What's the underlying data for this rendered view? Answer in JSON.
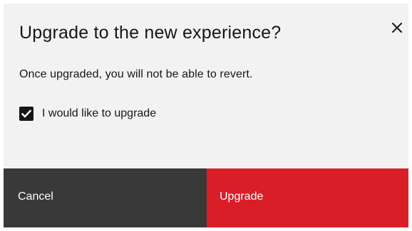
{
  "modal": {
    "title": "Upgrade to the new experience?",
    "body": "Once upgraded, you will not be able to revert.",
    "checkbox": {
      "label": "I would like to upgrade",
      "checked": true
    },
    "close_icon": "close-icon",
    "buttons": {
      "cancel_label": "Cancel",
      "upgrade_label": "Upgrade"
    }
  },
  "colors": {
    "background": "#f2f2f2",
    "text": "#161616",
    "secondary_button": "#393939",
    "danger_button": "#da1e28",
    "button_text": "#ffffff"
  }
}
